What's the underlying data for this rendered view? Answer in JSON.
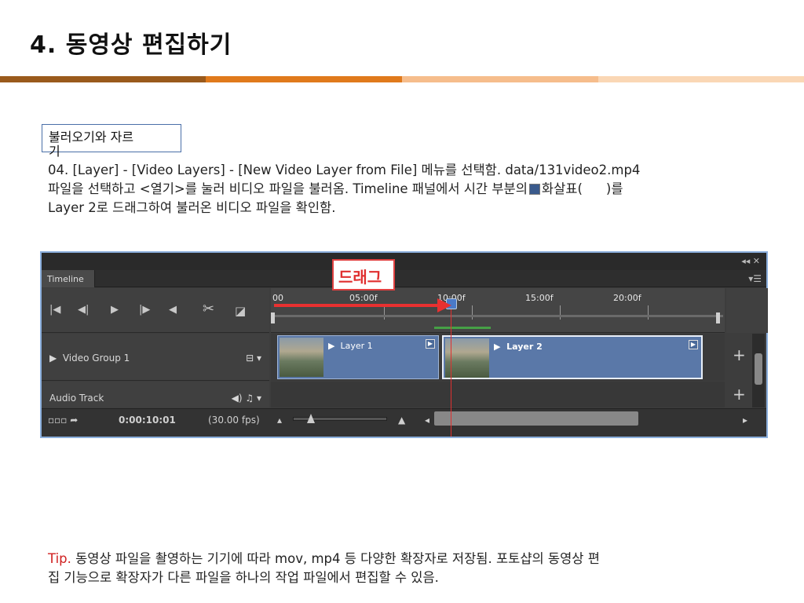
{
  "page": {
    "title": "4. 동영상 편집하기"
  },
  "step": {
    "label_line1": "불러오기와 자르",
    "label_line2": "기"
  },
  "description": {
    "line1": "04. [Layer] - [Video Layers] - [New Video Layer from File] 메뉴를 선택함. data/131video2.mp4",
    "line2_a": "파일을 선택하고 <열기>를 눌러 비디오 파일을 불러옴. Timeline 패널에서 시간 부분의",
    "line2_b": "화살표(",
    "line2_c": ")를",
    "line3": "Layer 2로 드래그하여 불러온 비디오 파일을 확인함."
  },
  "timeline": {
    "tab": "Timeline",
    "top_controls": "◂◂  ✕",
    "menu_icon": "▾☰",
    "drag_callout": "드래그",
    "ticks": [
      "00",
      "05:00f",
      "10:00f",
      "15:00f",
      "20:00f"
    ],
    "tracks": {
      "video_group": "Video Group 1",
      "video_group_icons": "⊟ ▾",
      "audio_track": "Audio Track",
      "audio_icons": "◀) ♫ ▾"
    },
    "clips": [
      {
        "label": "Layer 1"
      },
      {
        "label": "Layer 2"
      }
    ],
    "bottom": {
      "left_icons": "▫▫▫  ➦",
      "timecode": "0:00:10:01",
      "fps": "(30.00 fps)"
    }
  },
  "tip": {
    "label": "Tip.",
    "line1": " 동영상 파일을 촬영하는 기기에 따라 mov, mp4 등 다양한 확장자로 저장됨. 포토샵의 동영상 편",
    "line2": "집 기능으로 확장자가 다른 파일을 하나의 작업 파일에서 편집할 수 있음."
  },
  "colors": {
    "accent_brown": "#9a5a1c",
    "accent_orange": "#e07a1c",
    "callout_red": "#e03030",
    "clip_blue": "#5a78a8"
  }
}
